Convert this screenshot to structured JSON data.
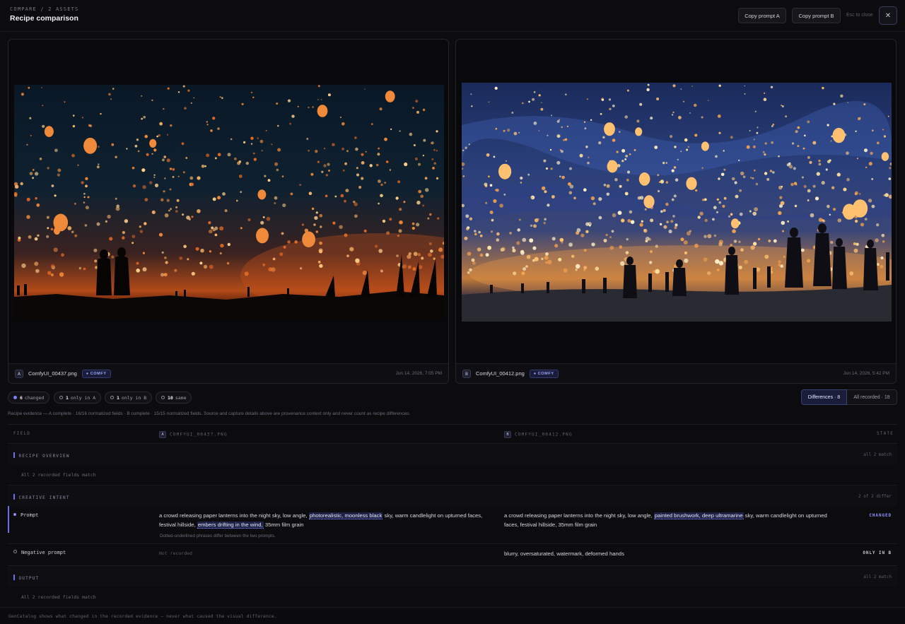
{
  "header": {
    "breadcrumb": "COMPARE / 2 ASSETS",
    "title": "Recipe comparison",
    "copy_a_label": "Copy prompt A",
    "copy_b_label": "Copy prompt B",
    "esc_hint": "Esc to close",
    "close_glyph": "✕"
  },
  "assets": {
    "a": {
      "letter": "A",
      "filename": "ComfyUI_00437.png",
      "tag": "COMFY",
      "date": "Jun 14, 2026, 7:05 PM"
    },
    "b": {
      "letter": "B",
      "filename": "ComfyUI_00412.png",
      "tag": "COMFY",
      "date": "Jun 14, 2026, 5:42 PM"
    }
  },
  "chips": {
    "changed": {
      "count": "6",
      "label": "changed"
    },
    "only_a": {
      "count": "1",
      "label": "only in A"
    },
    "only_b": {
      "count": "1",
      "label": "only in B"
    },
    "same": {
      "count": "10",
      "label": "same"
    }
  },
  "toggles": {
    "differences": "Differences · 8",
    "all": "All recorded · 18"
  },
  "evidence": "Recipe evidence — A complete · 16/16 normalized fields · B complete · 15/15 normalized fields. Source and capture details above are provenance context only and never count as recipe differences.",
  "table": {
    "col_field": "FIELD",
    "col_a": "COMFYUI_00437.PNG",
    "col_b": "COMFYUI_00412.PNG",
    "col_state": "STATE",
    "sections": {
      "overview": {
        "title": "RECIPE OVERVIEW",
        "meta": "all 2 match",
        "note": "All 2 recorded fields match"
      },
      "intent": {
        "title": "CREATIVE INTENT",
        "meta": "2 of 2 differ"
      },
      "output": {
        "title": "OUTPUT",
        "meta": "all 2 match",
        "note": "All 2 recorded fields match"
      }
    },
    "prompt": {
      "label": "Prompt",
      "a": {
        "p1": "a crowd releasing paper lanterns into the night sky, low angle, ",
        "h1": "photorealistic, moonless black",
        "p2": " sky, warm candlelight on upturned faces, festival hillside, ",
        "h2": "embers drifting in the wind,",
        "p3": " 35mm film grain"
      },
      "b": {
        "p1": "a crowd releasing paper lanterns into the night sky, low angle, ",
        "h1": "painted brushwork, deep ultramarine",
        "p2": " sky, warm candlelight on upturned faces, festival hillside, 35mm film grain"
      },
      "state": "CHANGED",
      "note": "Dotted-underlined phrases differ between the two prompts."
    },
    "negative": {
      "label": "Negative prompt",
      "a": "Not recorded",
      "b": "blurry, oversaturated, watermark, deformed hands",
      "state": "ONLY IN B"
    }
  },
  "footer": "GenCatalog shows what changed in the recorded evidence — never what caused the visual difference.",
  "colors": {
    "accent": "#6b72e8",
    "background": "#0c0c0f"
  }
}
